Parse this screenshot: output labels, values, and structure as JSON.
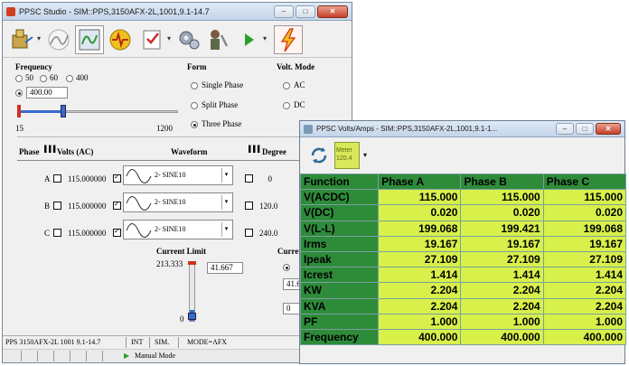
{
  "main_window": {
    "title": "PPSC Studio - SIM::PPS,3150AFX-2L,1001,9.1-14.7",
    "frequency": {
      "heading": "Frequency",
      "options": [
        "50",
        "60",
        "400"
      ],
      "custom_value": "400.00",
      "slider_min": "15",
      "slider_max": "1200"
    },
    "form": {
      "heading": "Form",
      "options": [
        "Single Phase",
        "Split Phase",
        "Three Phase"
      ],
      "selected": "Three Phase"
    },
    "volt_mode": {
      "heading": "Volt. Mode",
      "options": [
        "AC",
        "DC"
      ]
    },
    "grid": {
      "headers": [
        "Phase",
        "Volts (AC)",
        "Waveform",
        "Degree"
      ],
      "rows": [
        {
          "phase": "A",
          "volts": "115.000000",
          "waveform": "2- SINE10",
          "degree": "0"
        },
        {
          "phase": "B",
          "volts": "115.000000",
          "waveform": "2- SINE10",
          "degree": "120.0"
        },
        {
          "phase": "C",
          "volts": "115.000000",
          "waveform": "2- SINE10",
          "degree": "240.0"
        }
      ]
    },
    "current_limit": {
      "heading": "Current Limit",
      "scale_top": "213.333",
      "scale_bottom": "0",
      "value": "41.667",
      "level_fraction": 0.195
    },
    "current_right": {
      "heading": "Curren",
      "field1": "41.6",
      "field2": "0"
    },
    "status": {
      "model": "PPS 3150AFX-2L 1001 9.1-14.7",
      "interface": "INT",
      "sim": "SIM.",
      "mode": "MODE=AFX",
      "run_mode": "Manual Mode"
    }
  },
  "va_window": {
    "title": "PPSC Volts/Amps - SIM::PPS,3150AFX-2L,1001,9.1-1...",
    "meter_button_label": "Meter 120.4",
    "columns": [
      "Function",
      "Phase A",
      "Phase B",
      "Phase C"
    ],
    "rows": [
      {
        "fn": "V(ACDC)",
        "a": "115.000",
        "b": "115.000",
        "c": "115.000"
      },
      {
        "fn": "V(DC)",
        "a": "0.020",
        "b": "0.020",
        "c": "0.020"
      },
      {
        "fn": "V(L-L)",
        "a": "199.068",
        "b": "199.421",
        "c": "199.068"
      },
      {
        "fn": "Irms",
        "a": "19.167",
        "b": "19.167",
        "c": "19.167"
      },
      {
        "fn": "Ipeak",
        "a": "27.109",
        "b": "27.109",
        "c": "27.109"
      },
      {
        "fn": "Icrest",
        "a": "1.414",
        "b": "1.414",
        "c": "1.414"
      },
      {
        "fn": "KW",
        "a": "2.204",
        "b": "2.204",
        "c": "2.204"
      },
      {
        "fn": "KVA",
        "a": "2.204",
        "b": "2.204",
        "c": "2.204"
      },
      {
        "fn": "PF",
        "a": "1.000",
        "b": "1.000",
        "c": "1.000"
      },
      {
        "fn": "Frequency",
        "a": "400.000",
        "b": "400.000",
        "c": "400.000"
      }
    ]
  },
  "colors": {
    "table_header_green": "#2e8b3a",
    "table_value_yellow": "#d8f04a",
    "close_button_red": "#c4412b"
  }
}
